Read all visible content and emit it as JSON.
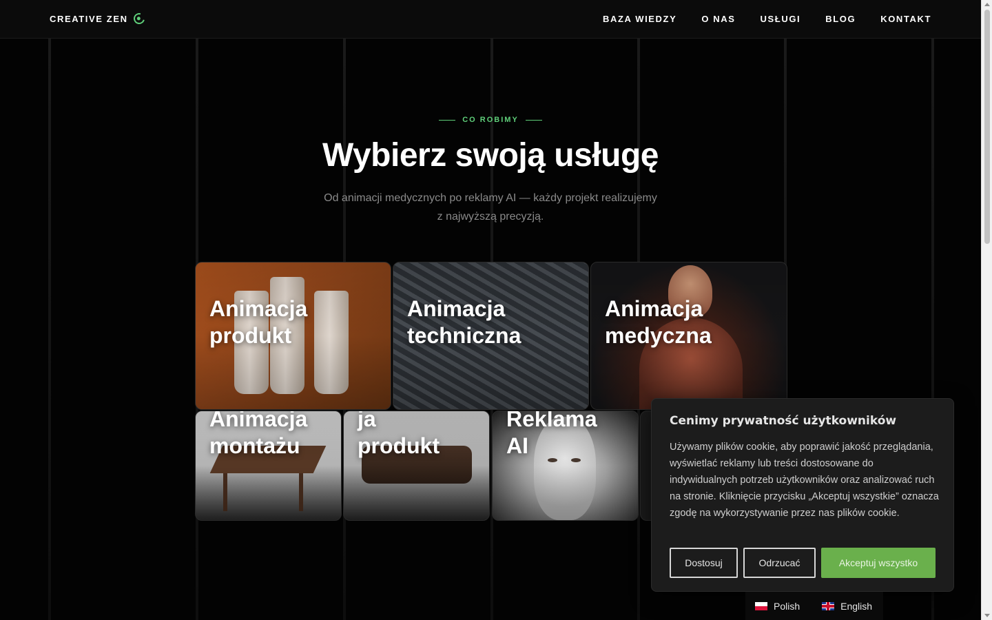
{
  "header": {
    "logo_text": "CREATIVE ZEN",
    "nav": [
      {
        "label": "BAZA WIEDZY"
      },
      {
        "label": "O NAS"
      },
      {
        "label": "USŁUGI"
      },
      {
        "label": "BLOG"
      },
      {
        "label": "KONTAKT"
      }
    ]
  },
  "section": {
    "eyebrow": "CO ROBIMY",
    "title": "Wybierz swoją usługę",
    "subtitle_line1": "Od animacji medycznych po reklamy AI — każdy projekt realizujemy",
    "subtitle_line2": "z najwyższą precyzją."
  },
  "cards": [
    {
      "title": "Animacja\nprodukt"
    },
    {
      "title": "Animacja\ntechniczna"
    },
    {
      "title": "Animacja\nmedyczna"
    },
    {
      "title": "Animacja\nmontażu"
    },
    {
      "title": "ja\nprodukt"
    },
    {
      "title": "Reklama\nAI"
    }
  ],
  "cookie": {
    "title": "Cenimy prywatność użytkowników",
    "text": "Używamy plików cookie, aby poprawić jakość przeglądania, wyświetlać reklamy lub treści dostosowane do indywidualnych potrzeb użytkowników oraz analizować ruch na stronie. Kliknięcie przycisku „Akceptuj wszystkie” oznacza zgodę na wykorzystywanie przez nas plików cookie.",
    "btn_customize": "Dostosuj",
    "btn_reject": "Odrzucać",
    "btn_accept": "Akceptuj wszystko"
  },
  "languages": [
    {
      "label": "Polish",
      "flag": "flag-pl"
    },
    {
      "label": "English",
      "flag": "flag-en"
    }
  ],
  "colors": {
    "accent_green": "#5fcf7a",
    "accept_button": "#6ab04c",
    "background": "#030303"
  }
}
